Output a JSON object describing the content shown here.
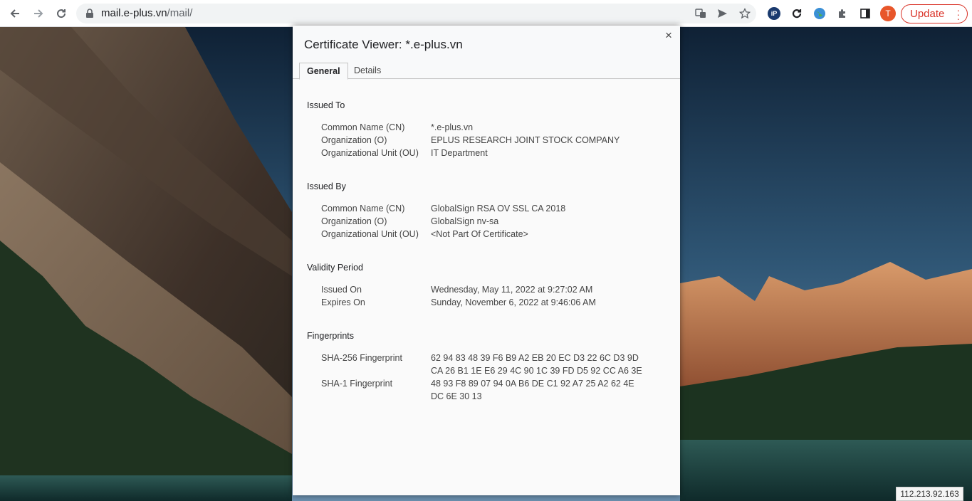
{
  "browser": {
    "url_host": "mail.e-plus.vn",
    "url_path": "/mail/",
    "update_label": "Update",
    "avatar_initial": "T",
    "extension_label": "iP"
  },
  "dialog": {
    "title": "Certificate Viewer: *.e-plus.vn",
    "close_glyph": "×",
    "tabs": [
      {
        "label": "General"
      },
      {
        "label": "Details"
      }
    ],
    "issued_to": {
      "heading": "Issued To",
      "rows": [
        {
          "label": "Common Name (CN)",
          "value": "*.e-plus.vn"
        },
        {
          "label": "Organization (O)",
          "value": "EPLUS RESEARCH JOINT STOCK COMPANY"
        },
        {
          "label": "Organizational Unit (OU)",
          "value": "IT Department"
        }
      ]
    },
    "issued_by": {
      "heading": "Issued By",
      "rows": [
        {
          "label": "Common Name (CN)",
          "value": "GlobalSign RSA OV SSL CA 2018"
        },
        {
          "label": "Organization (O)",
          "value": "GlobalSign nv-sa"
        },
        {
          "label": "Organizational Unit (OU)",
          "value": "<Not Part Of Certificate>"
        }
      ]
    },
    "validity": {
      "heading": "Validity Period",
      "rows": [
        {
          "label": "Issued On",
          "value": "Wednesday, May 11, 2022 at 9:27:02 AM"
        },
        {
          "label": "Expires On",
          "value": "Sunday, November 6, 2022 at 9:46:06 AM"
        }
      ]
    },
    "fingerprints": {
      "heading": "Fingerprints",
      "sha256_label": "SHA-256 Fingerprint",
      "sha256_line1": "62 94 83 48 39 F6 B9 A2 EB 20 EC D3 22 6C D3 9D",
      "sha256_line2": "CA 26 B1 1E E6 29 4C 90 1C 39 FD D5 92 CC A6 3E",
      "sha1_label": "SHA-1 Fingerprint",
      "sha1_line1": "48 93 F8 89 07 94 0A B6 DE C1 92 A7 25 A2 62 4E",
      "sha1_line2": "DC 6E 30 13"
    }
  },
  "ip_badge": "112.213.92.163"
}
